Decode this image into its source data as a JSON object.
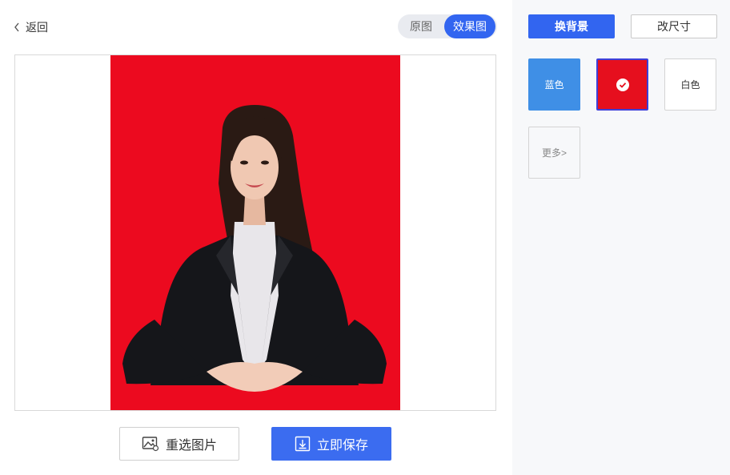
{
  "header": {
    "back_label": "返回",
    "view_toggle": {
      "original_label": "原图",
      "effect_label": "效果图",
      "selected": "效果图"
    }
  },
  "preview": {
    "background_color": "#ec0a1f",
    "subject": "woman in black suit, white shirt, seated with hands folded"
  },
  "actions": {
    "reselect_label": "重选图片",
    "save_label": "立即保存"
  },
  "side_panel": {
    "tabs": [
      {
        "label": "换背景",
        "active": true
      },
      {
        "label": "改尺寸",
        "active": false
      }
    ],
    "colors": [
      {
        "label": "蓝色",
        "color": "#3f8fe6",
        "selected": false
      },
      {
        "label": "",
        "color": "#e60f1e",
        "selected": true
      },
      {
        "label": "白色",
        "color": "#ffffff",
        "selected": false
      }
    ],
    "more_label": "更多>"
  },
  "colors": {
    "accent": "#3265f0",
    "save_button": "#3b6cf0",
    "panel_bg": "#f7f8fa"
  }
}
